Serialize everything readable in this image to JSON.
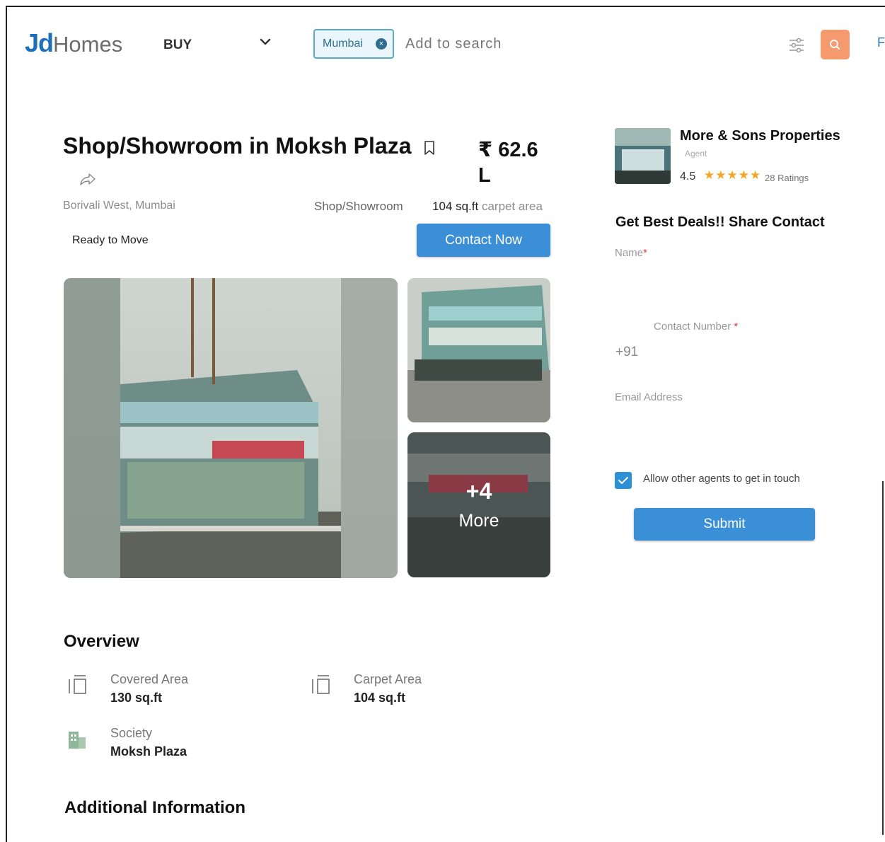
{
  "header": {
    "logo_jd": "Jd",
    "logo_homes": "Homes",
    "mode_label": "BUY",
    "city_chip": "Mumbai",
    "chip_close": "×",
    "search_placeholder": "Add to search",
    "partial_text": "F"
  },
  "listing": {
    "title": "Shop/Showroom in Moksh Plaza",
    "price": "₹ 62.6 L",
    "location": "Borivali West, Mumbai",
    "property_type": "Shop/Showroom",
    "area_value": "104 sq.ft",
    "area_unit": "carpet area",
    "status": "Ready to Move",
    "contact_label": "Contact Now",
    "more_count": "+4",
    "more_label": "More"
  },
  "overview": {
    "heading": "Overview",
    "items": [
      {
        "label": "Covered Area",
        "value": "130 sq.ft",
        "icon": "area-icon"
      },
      {
        "label": "Carpet Area",
        "value": "104 sq.ft",
        "icon": "area-icon"
      },
      {
        "label": "Society",
        "value": "Moksh Plaza",
        "icon": "building-icon"
      }
    ]
  },
  "additional": {
    "heading": "Additional Information"
  },
  "agent": {
    "name": "More & Sons Properties",
    "role": "Agent",
    "rating": "4.5",
    "stars": "★★★★★",
    "ratings_count": "28 Ratings"
  },
  "form": {
    "heading": "Get Best Deals!! Share Contact",
    "name_label": "Name",
    "contact_label": "Contact Number",
    "required_mark": "*",
    "phone_prefix": "+91",
    "email_label": "Email Address",
    "allow_label": "Allow other agents to get in touch",
    "allow_checked": true,
    "submit_label": "Submit"
  },
  "colors": {
    "brand_blue": "#1c6fb8",
    "button_blue": "#3a8fd6",
    "search_orange": "#f59a6e",
    "star": "#f5a623"
  }
}
